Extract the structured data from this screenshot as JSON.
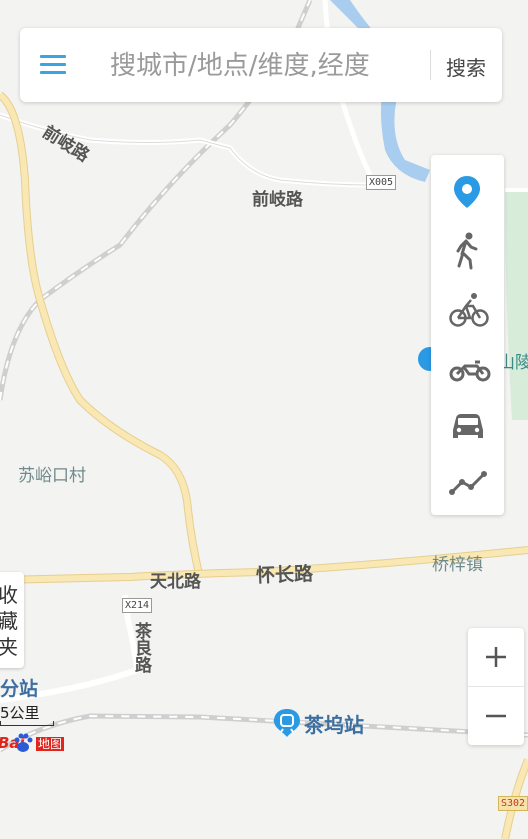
{
  "search": {
    "placeholder": "搜城市/地点/维度,经度",
    "button_label": "搜索",
    "menu_icon": "menu-icon"
  },
  "transport_modes": [
    {
      "name": "location-pin-icon",
      "color": "#2a9ae4"
    },
    {
      "name": "walk-icon",
      "color": "#666666"
    },
    {
      "name": "bicycle-icon",
      "color": "#666666"
    },
    {
      "name": "motorcycle-icon",
      "color": "#666666"
    },
    {
      "name": "car-icon",
      "color": "#666666"
    },
    {
      "name": "route-line-icon",
      "color": "#666666"
    }
  ],
  "map": {
    "road_labels": {
      "qianqi_road_1": "前岐路",
      "qianqi_road_2": "前岐路",
      "tianbei_road": "天北路",
      "huaichang_road": "怀长路",
      "chaliang_road": "茶良路"
    },
    "place_labels": {
      "suyukou_village": "苏峪口村",
      "qiaozi_town": "桥梓镇",
      "partial_station": "分站",
      "partial_mausoleum": "山陵"
    },
    "station": {
      "label": "茶坞站",
      "icon": "subway-station-icon"
    },
    "road_badges": {
      "x005": "X005",
      "x214": "X214",
      "s302": "S302"
    }
  },
  "favorites": {
    "chars": [
      "收",
      "藏",
      "夹"
    ]
  },
  "zoom": {
    "in_label": "+",
    "out_label": "−"
  },
  "scale": {
    "label": "5公里"
  },
  "logo": {
    "text_1": "Bai",
    "text_2": "地图",
    "icon": "paw-icon"
  },
  "colors": {
    "accent": "#3aa3e3",
    "road_major": "#f6e2a8",
    "water": "#a9cdef",
    "park": "#d7ecd9",
    "rail": "#c9c9c9"
  }
}
